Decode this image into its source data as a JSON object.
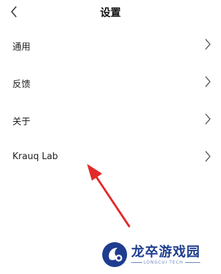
{
  "header": {
    "title": "设置",
    "back_icon": "chevron-left-icon"
  },
  "settings": {
    "items": [
      {
        "label": "通用",
        "icon": "chevron-right-icon"
      },
      {
        "label": "反馈",
        "icon": "chevron-right-icon"
      },
      {
        "label": "关于",
        "icon": "chevron-right-icon"
      },
      {
        "label": "Krauq Lab",
        "icon": "chevron-right-icon"
      }
    ]
  },
  "annotation": {
    "color": "#e12a2a"
  },
  "watermark": {
    "brand": "龙卒游戏园",
    "tagline": "LONGCUI TECH",
    "color": "#1f3d8f"
  }
}
